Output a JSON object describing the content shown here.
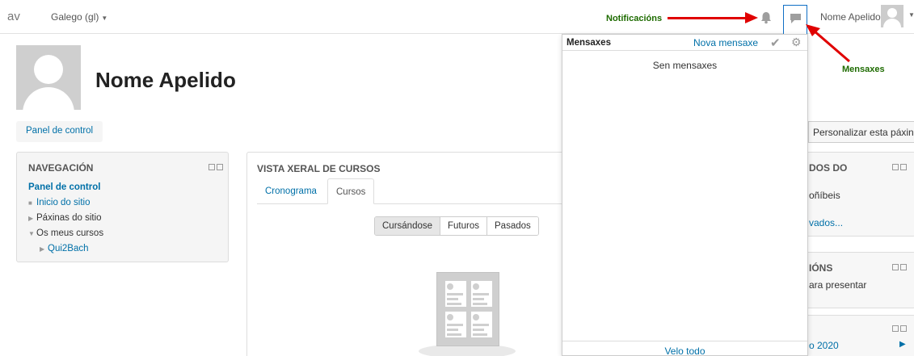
{
  "navbar": {
    "brand": "av",
    "language": "Galego (gl)",
    "user_name": "Nome Apelido"
  },
  "annotations": {
    "notifications": "Notificacións",
    "messages": "Mensaxes"
  },
  "page": {
    "title": "Nome Apelido",
    "breadcrumb": "Panel de control",
    "customize_button": "Personalizar esta páxina"
  },
  "navigation_block": {
    "title": "NAVEGACIÓN",
    "root": "Panel de control",
    "items": [
      "Inicio do sitio",
      "Páxinas do sitio",
      "Os meus cursos",
      "Qui2Bach"
    ]
  },
  "course_overview": {
    "title": "VISTA XERAL DE CURSOS",
    "tabs": [
      "Cronograma",
      "Cursos"
    ],
    "active_tab": "Cursos",
    "filters": [
      "Cursándose",
      "Futuros",
      "Pasados"
    ],
    "selected_filter": "Cursándose"
  },
  "messages_popover": {
    "title": "Mensaxes",
    "new_message": "Nova mensaxe",
    "empty": "Sen mensaxes",
    "view_all": "Velo todo"
  },
  "right_blocks": {
    "block1_title": "DOS DO",
    "block1_line1": "oñíbeis",
    "block1_link": "vados...",
    "block2_title": "IÓNS",
    "block2_text": "ara presentar",
    "block3_link": "o 2020"
  },
  "colors": {
    "link": "#0070a8",
    "annotation_green": "#1e6b00",
    "arrow_red": "#e00000",
    "active_border": "#0f6fc5"
  },
  "icons": [
    "bell-icon",
    "message-icon",
    "check-icon",
    "gear-icon",
    "chevron-right-icon"
  ]
}
